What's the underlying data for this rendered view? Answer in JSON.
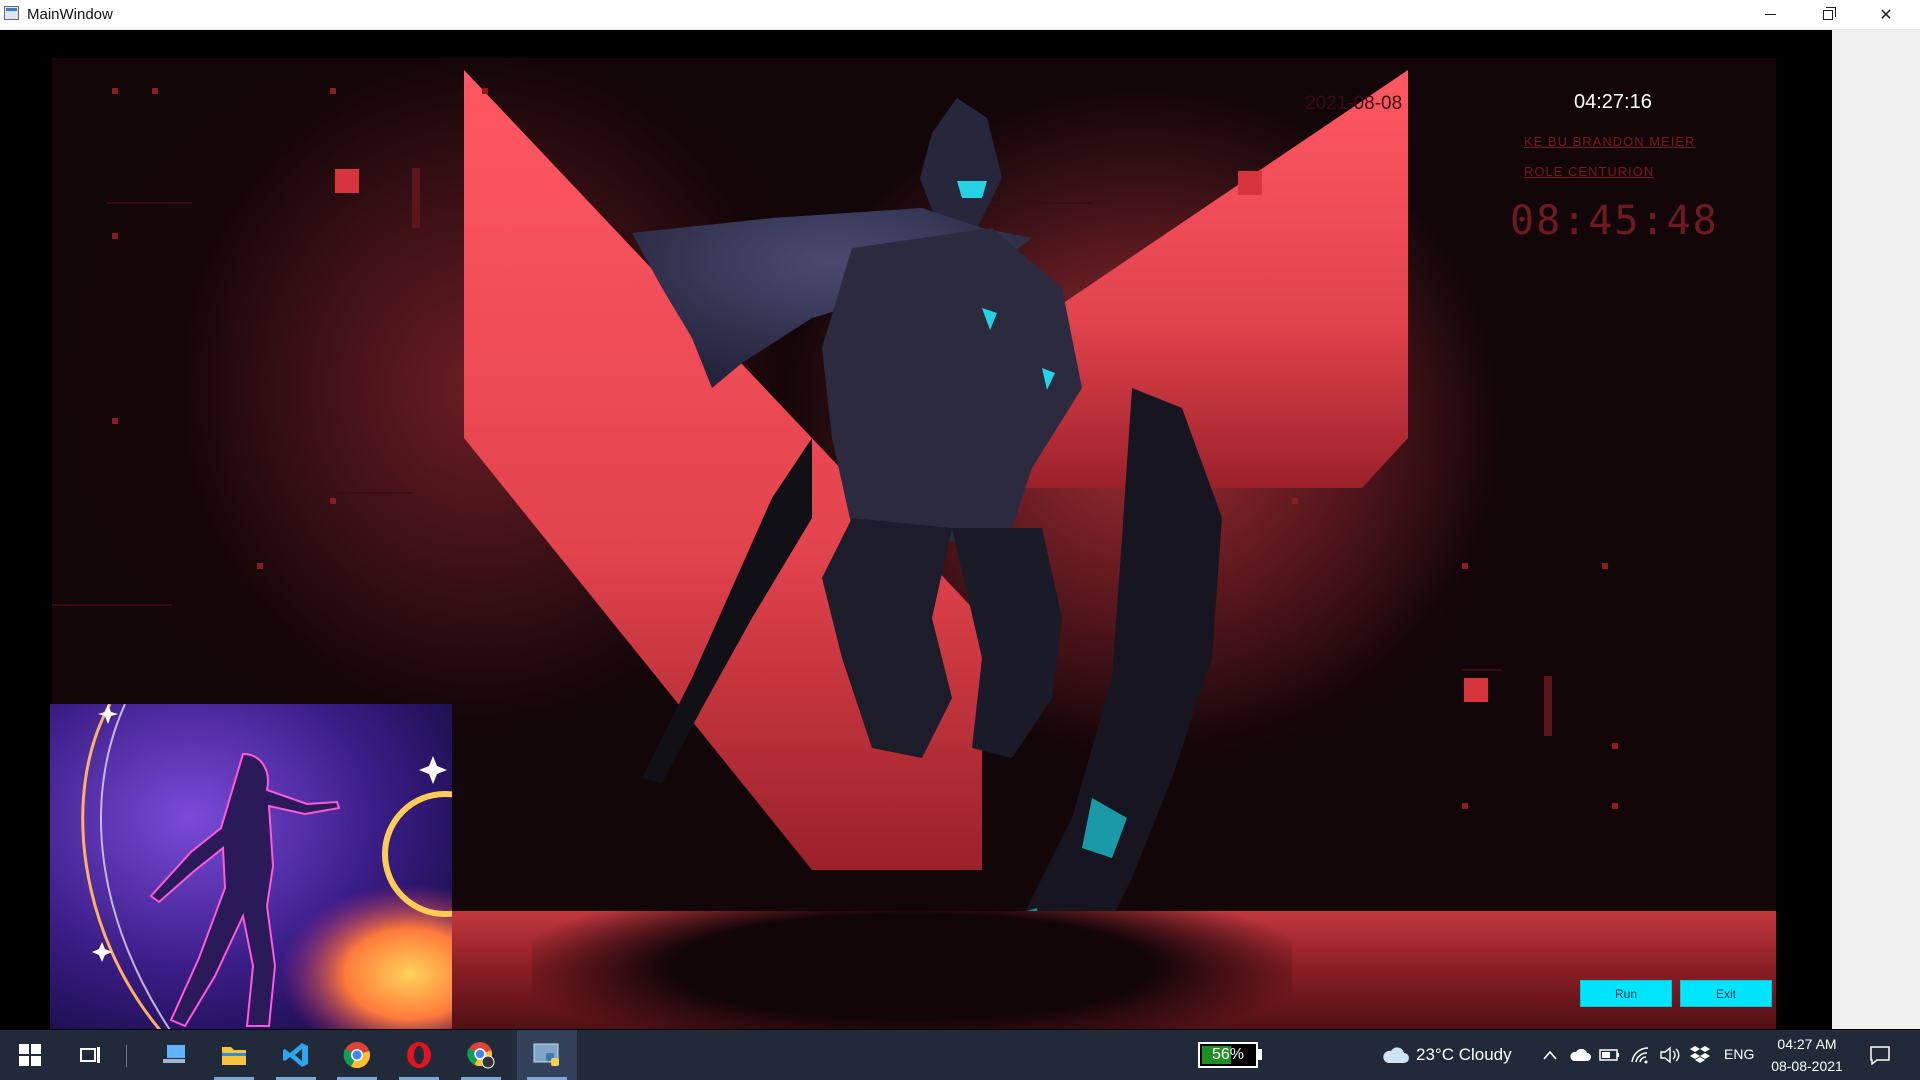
{
  "window": {
    "title": "MainWindow"
  },
  "overlay": {
    "date": "2021-08-08",
    "clock": "04:27:16",
    "deco_line1": "KE BU  BRANDON MEIER",
    "deco_line2": "ROLE  CENTURION",
    "deco_time": "08:45:48"
  },
  "buttons": {
    "run": "Run",
    "exit": "Exit"
  },
  "taskbar": {
    "apps": [
      "start-icon",
      "task-view-icon",
      "this-pc-icon",
      "file-explorer-icon",
      "vscode-icon",
      "chrome-icon",
      "opera-icon",
      "chrome-alt-icon",
      "python-app-icon"
    ],
    "battery": {
      "label": "56%",
      "level": 0.56
    },
    "weather": {
      "text": "23°C  Cloudy"
    },
    "language": "ENG",
    "time": "04:27 AM",
    "date": "08-08-2021"
  },
  "colors": {
    "accent": "#00e5ff",
    "hero_red": "#e2434d",
    "taskbar": "#202a38"
  }
}
